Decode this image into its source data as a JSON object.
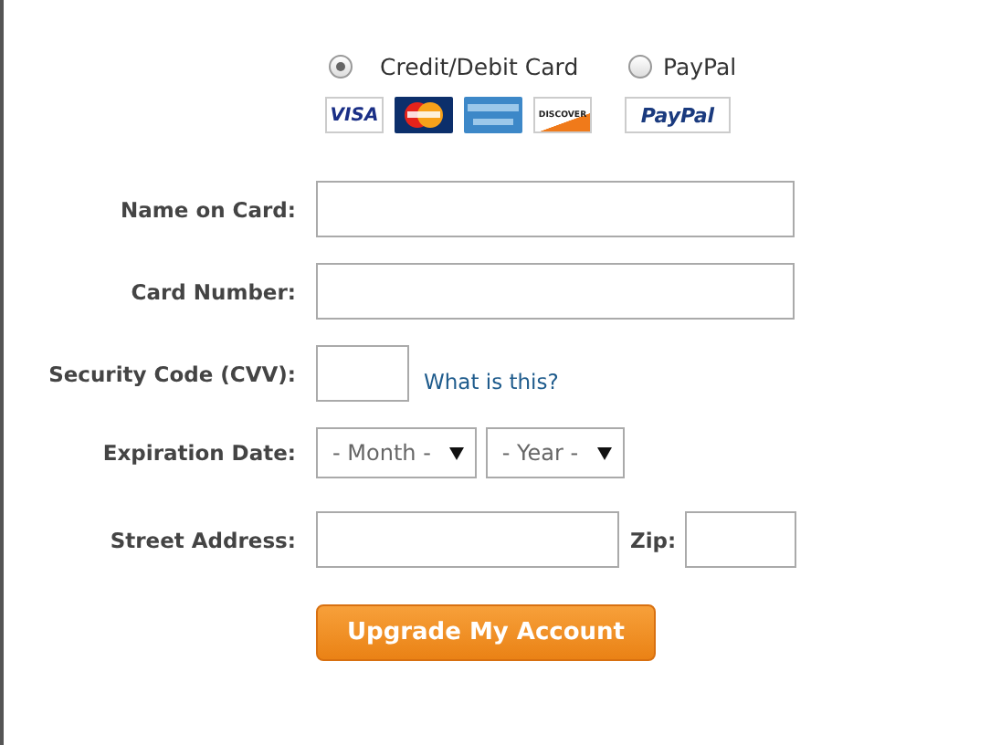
{
  "payment_methods": [
    {
      "label": "Credit/Debit Card",
      "selected": true,
      "logos": [
        {
          "kind": "visa",
          "text": "VISA"
        },
        {
          "kind": "mastercard"
        },
        {
          "kind": "amex"
        },
        {
          "kind": "discover",
          "text": "DISCOVER"
        }
      ]
    },
    {
      "label": "PayPal",
      "selected": false,
      "logos": [
        {
          "kind": "paypal",
          "text": "PayPal"
        }
      ]
    }
  ],
  "rows": [
    {
      "label": "Name on Card:",
      "controls": [
        {
          "kind": "wide_input"
        }
      ]
    },
    {
      "label": "Card Number:",
      "controls": [
        {
          "kind": "wide_input"
        }
      ]
    },
    {
      "label": "Security Code (CVV):",
      "controls": [
        {
          "kind": "small_input"
        },
        {
          "kind": "link",
          "text": "What is this?"
        }
      ]
    },
    {
      "label": "Expiration Date:",
      "controls": [
        {
          "kind": "select",
          "value": "- Month -"
        },
        {
          "kind": "select",
          "value": "- Year -"
        }
      ]
    },
    {
      "label": "Street Address:",
      "controls": [
        {
          "kind": "medium_input"
        },
        {
          "kind": "label",
          "text": "Zip:"
        },
        {
          "kind": "zip_input"
        }
      ]
    }
  ],
  "button": "Upgrade My Account"
}
